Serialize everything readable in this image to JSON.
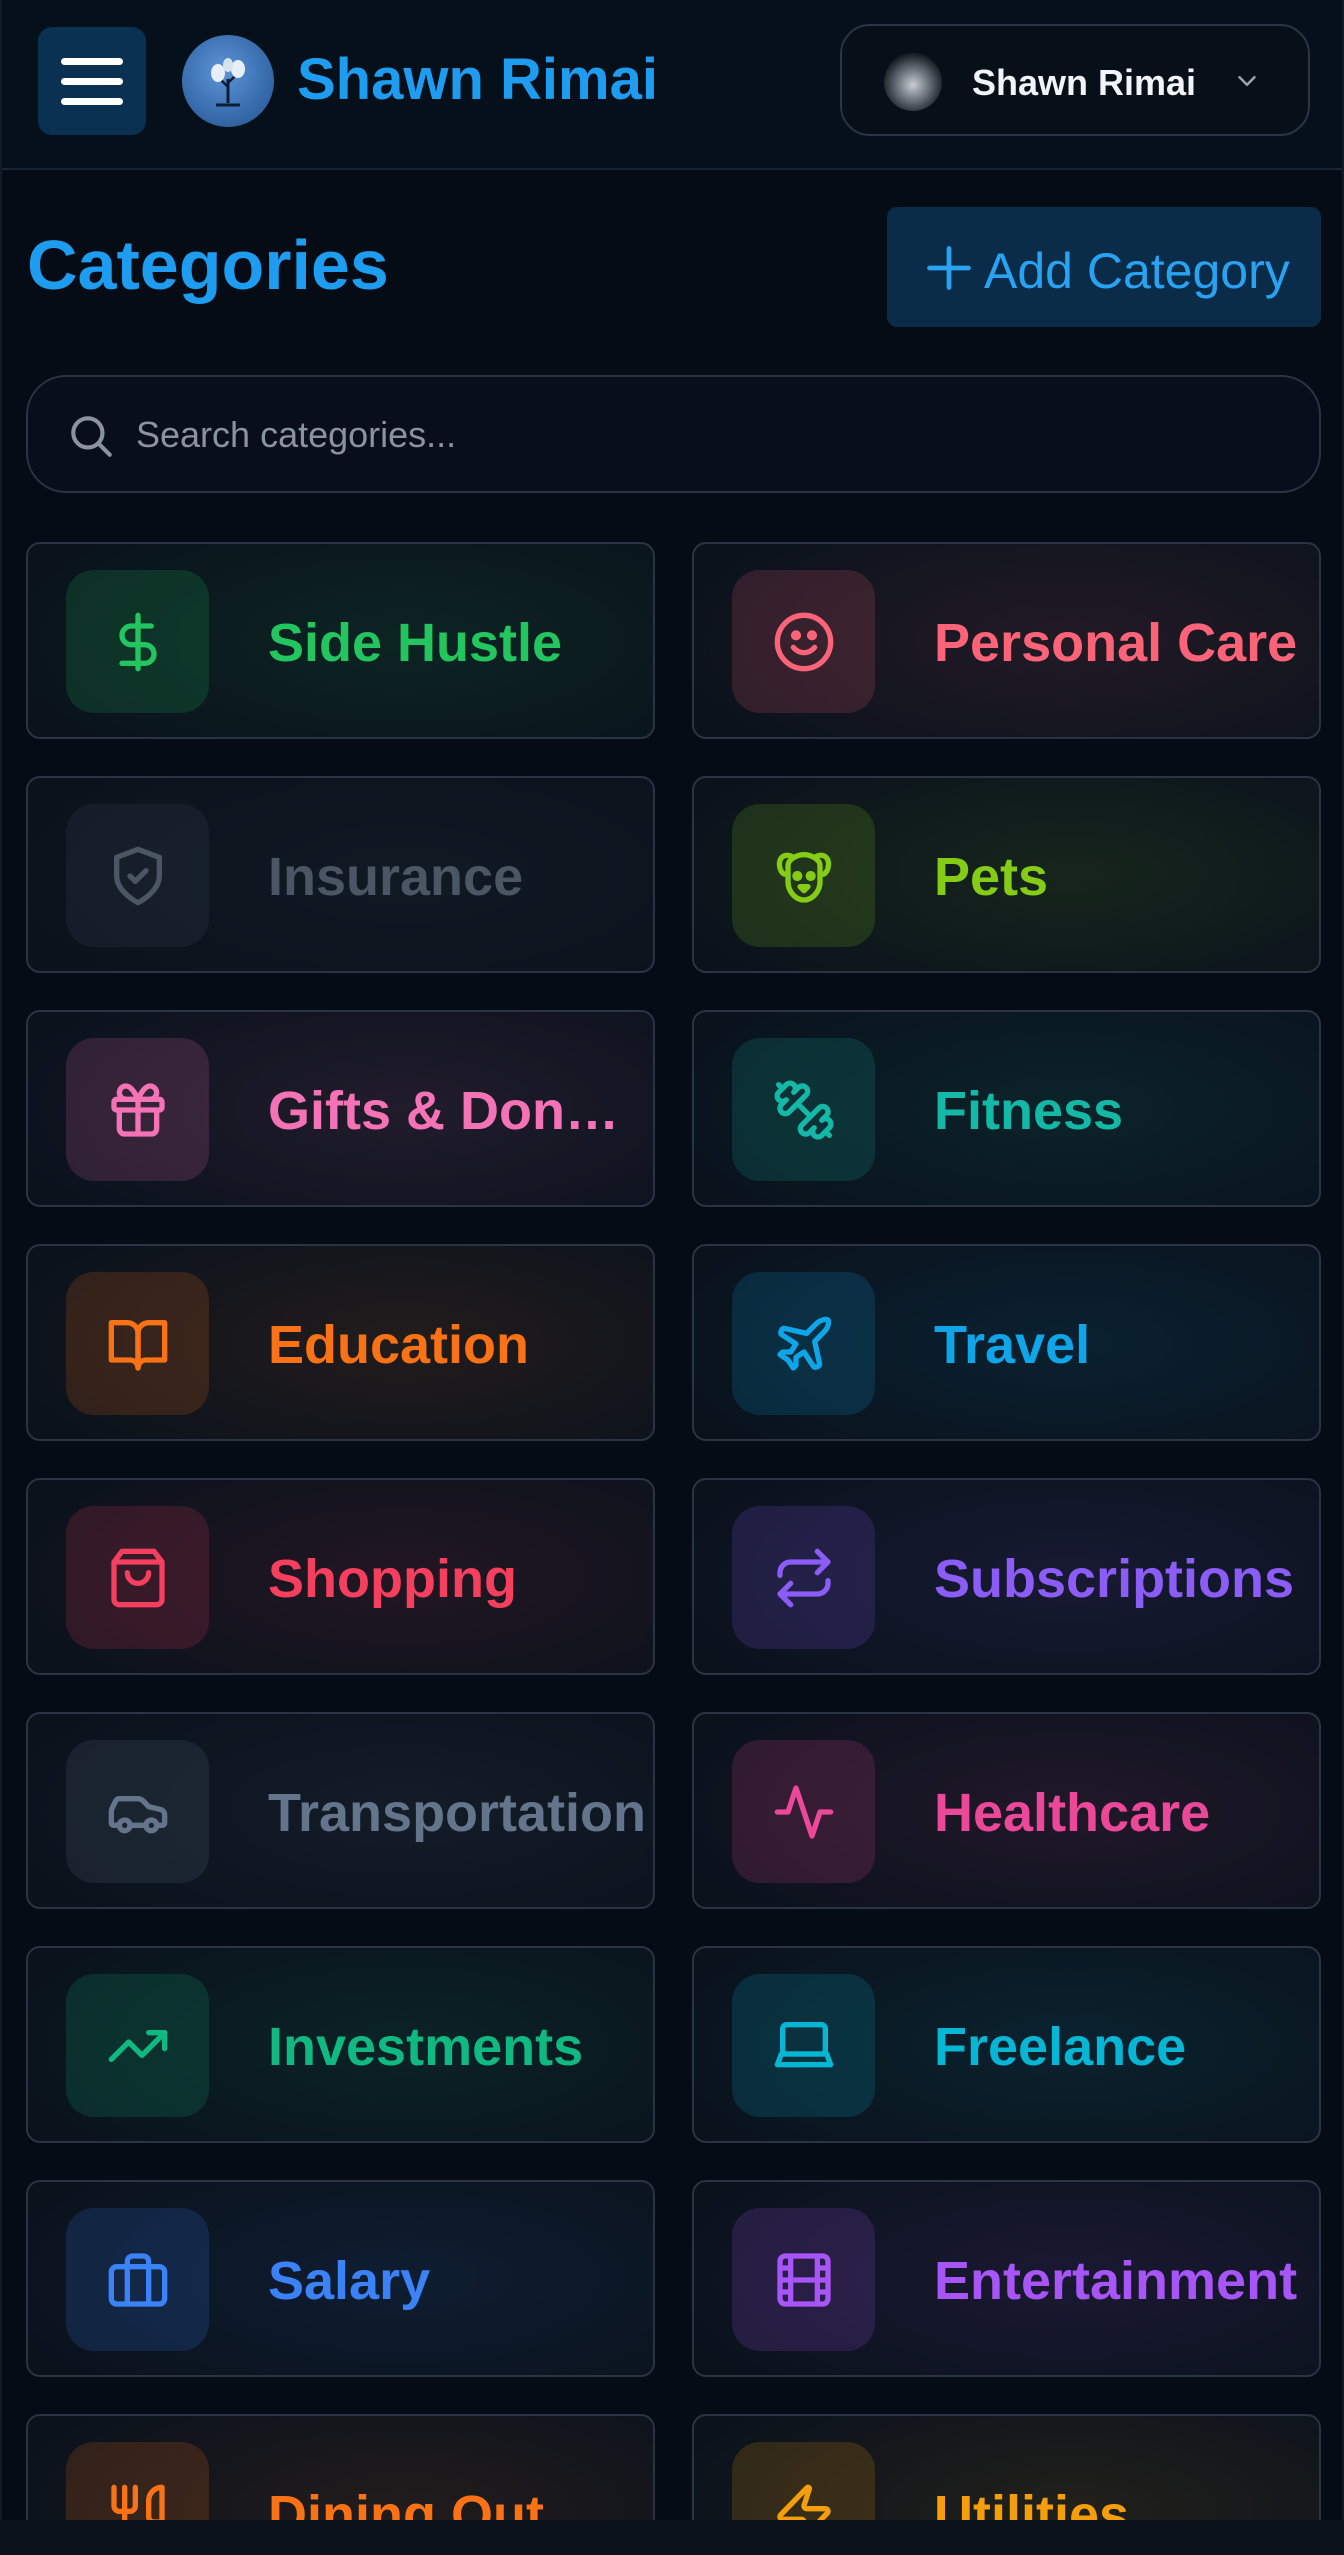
{
  "header": {
    "brand_title": "Shawn Rimai",
    "user_name": "Shawn Rimai"
  },
  "page": {
    "title": "Categories",
    "add_button_label": "Add Category"
  },
  "search": {
    "placeholder": "Search categories..."
  },
  "categories": [
    {
      "name": "Side Hustle",
      "icon": "dollar-icon",
      "color": "#22c55e"
    },
    {
      "name": "Personal Care",
      "icon": "smile-icon",
      "color": "#fb6478"
    },
    {
      "name": "Insurance",
      "icon": "shield-check-icon",
      "color": "#4b5563"
    },
    {
      "name": "Pets",
      "icon": "dog-icon",
      "color": "#84cc16"
    },
    {
      "name": "Gifts & Donations",
      "icon": "gift-icon",
      "color": "#f472b6"
    },
    {
      "name": "Fitness",
      "icon": "dumbbell-icon",
      "color": "#14b8a6"
    },
    {
      "name": "Education",
      "icon": "book-icon",
      "color": "#f97316"
    },
    {
      "name": "Travel",
      "icon": "plane-icon",
      "color": "#0ea5e9"
    },
    {
      "name": "Shopping",
      "icon": "shopping-bag-icon",
      "color": "#f43f5e"
    },
    {
      "name": "Subscriptions",
      "icon": "repeat-icon",
      "color": "#8b5cf6"
    },
    {
      "name": "Transportation",
      "icon": "car-icon",
      "color": "#64748b"
    },
    {
      "name": "Healthcare",
      "icon": "activity-icon",
      "color": "#ec4899"
    },
    {
      "name": "Investments",
      "icon": "trending-up-icon",
      "color": "#10b981"
    },
    {
      "name": "Freelance",
      "icon": "laptop-icon",
      "color": "#06b6d4"
    },
    {
      "name": "Salary",
      "icon": "briefcase-icon",
      "color": "#3b82f6"
    },
    {
      "name": "Entertainment",
      "icon": "film-icon",
      "color": "#a855f7"
    },
    {
      "name": "Dining Out",
      "icon": "utensils-icon",
      "color": "#f97316"
    },
    {
      "name": "Utilities",
      "icon": "zap-icon",
      "color": "#f59e0b"
    }
  ]
}
